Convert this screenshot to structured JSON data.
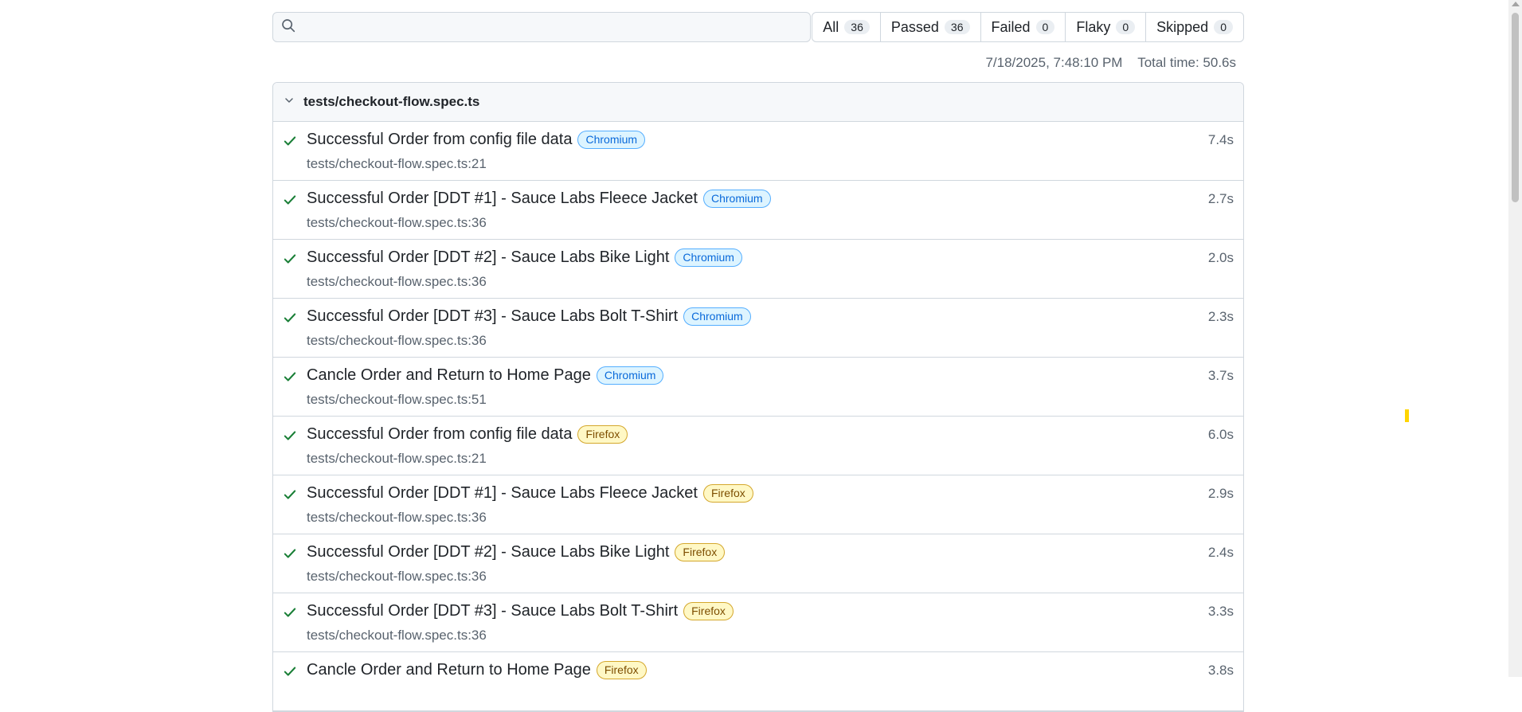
{
  "search": {
    "placeholder": "",
    "value": ""
  },
  "filters": [
    {
      "label": "All",
      "count": "36"
    },
    {
      "label": "Passed",
      "count": "36"
    },
    {
      "label": "Failed",
      "count": "0"
    },
    {
      "label": "Flaky",
      "count": "0"
    },
    {
      "label": "Skipped",
      "count": "0"
    }
  ],
  "meta": {
    "timestamp": "7/18/2025, 7:48:10 PM",
    "total_time": "Total time: 50.6s"
  },
  "file": {
    "title": "tests/checkout-flow.spec.ts",
    "tests": [
      {
        "title": "Successful Order from config file data",
        "project": "Chromium",
        "project_type": "chromium",
        "location": "tests/checkout-flow.spec.ts:21",
        "duration": "7.4s"
      },
      {
        "title": "Successful Order [DDT #1] - Sauce Labs Fleece Jacket",
        "project": "Chromium",
        "project_type": "chromium",
        "location": "tests/checkout-flow.spec.ts:36",
        "duration": "2.7s"
      },
      {
        "title": "Successful Order [DDT #2] - Sauce Labs Bike Light",
        "project": "Chromium",
        "project_type": "chromium",
        "location": "tests/checkout-flow.spec.ts:36",
        "duration": "2.0s"
      },
      {
        "title": "Successful Order [DDT #3] - Sauce Labs Bolt T-Shirt",
        "project": "Chromium",
        "project_type": "chromium",
        "location": "tests/checkout-flow.spec.ts:36",
        "duration": "2.3s"
      },
      {
        "title": "Cancle Order and Return to Home Page",
        "project": "Chromium",
        "project_type": "chromium",
        "location": "tests/checkout-flow.spec.ts:51",
        "duration": "3.7s"
      },
      {
        "title": "Successful Order from config file data",
        "project": "Firefox",
        "project_type": "firefox",
        "location": "tests/checkout-flow.spec.ts:21",
        "duration": "6.0s"
      },
      {
        "title": "Successful Order [DDT #1] - Sauce Labs Fleece Jacket",
        "project": "Firefox",
        "project_type": "firefox",
        "location": "tests/checkout-flow.spec.ts:36",
        "duration": "2.9s"
      },
      {
        "title": "Successful Order [DDT #2] - Sauce Labs Bike Light",
        "project": "Firefox",
        "project_type": "firefox",
        "location": "tests/checkout-flow.spec.ts:36",
        "duration": "2.4s"
      },
      {
        "title": "Successful Order [DDT #3] - Sauce Labs Bolt T-Shirt",
        "project": "Firefox",
        "project_type": "firefox",
        "location": "tests/checkout-flow.spec.ts:36",
        "duration": "3.3s"
      },
      {
        "title": "Cancle Order and Return to Home Page",
        "project": "Firefox",
        "project_type": "firefox",
        "location": "",
        "duration": "3.8s"
      }
    ]
  },
  "icons": {
    "search": "search-icon",
    "collapse": "chevron-down-icon",
    "pass": "check-icon"
  },
  "colors": {
    "pass": "#1a7f37",
    "chromium_tag": "#0969da",
    "firefox_tag": "#7d4e00"
  }
}
